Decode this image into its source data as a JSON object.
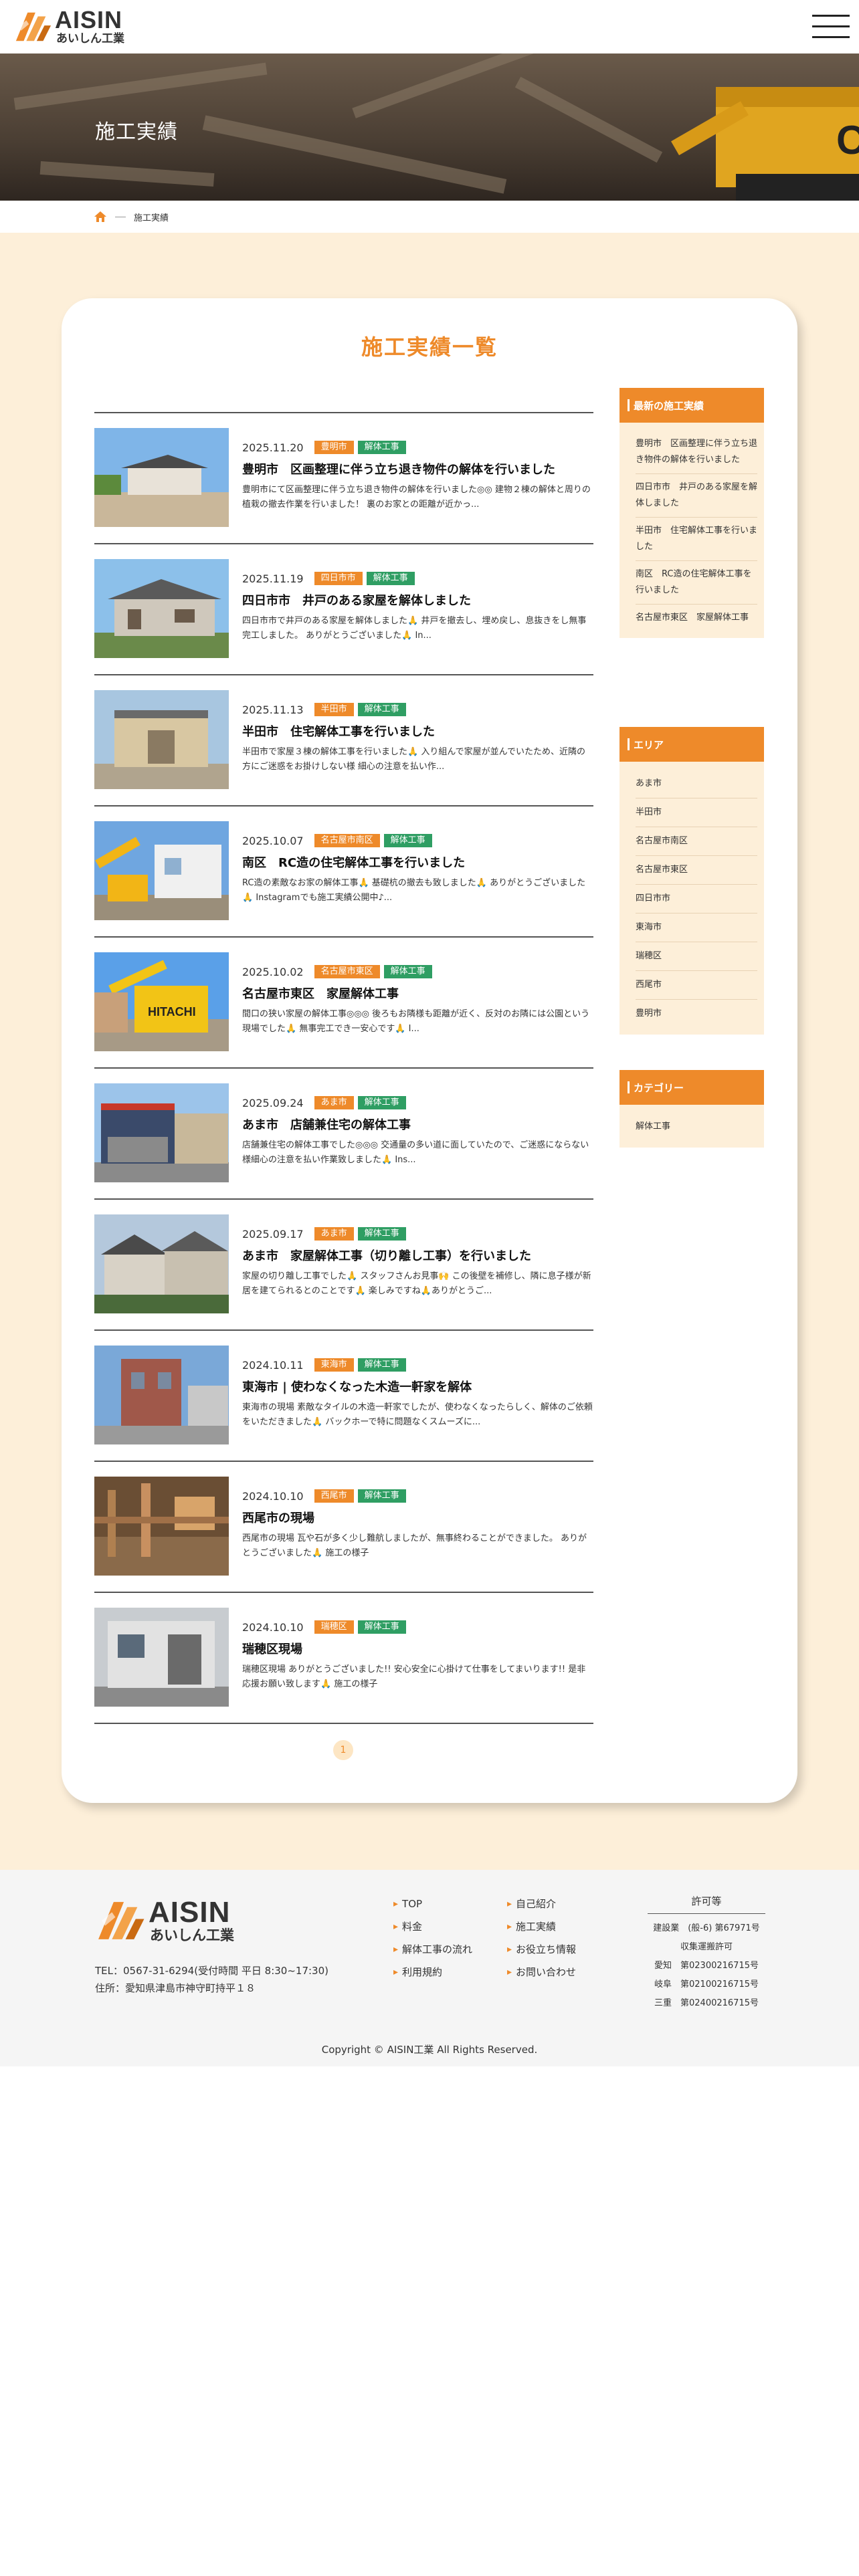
{
  "header": {
    "logo_en": "AISIN",
    "logo_ja": "あいしん工業",
    "menu_icon": "hamburger-icon"
  },
  "hero": {
    "title": "施工実績"
  },
  "breadcrumb": {
    "home_icon": "home-icon",
    "current": "施工実績"
  },
  "section_title": "施工実績一覧",
  "posts": [
    {
      "date": "2025.11.20",
      "area": "豊明市",
      "category": "解体工事",
      "title": "豊明市　区画整理に伴う立ち退き物件の解体を行いました",
      "excerpt": "豊明市にて区画整理に伴う立ち退き物件の解体を行いました◎◎ 建物２棟の解体と周りの植栽の撤去作業を行いました！ 裏のお家との距離が近かっ..."
    },
    {
      "date": "2025.11.19",
      "area": "四日市市",
      "category": "解体工事",
      "title": "四日市市　井戸のある家屋を解体しました",
      "excerpt": "四日市市で井戸のある家屋を解体しました🙏 井戸を撤去し、埋め戻し、息抜きをし無事完工しました。 ありがとうございました🙏 In..."
    },
    {
      "date": "2025.11.13",
      "area": "半田市",
      "category": "解体工事",
      "title": "半田市　住宅解体工事を行いました",
      "excerpt": "半田市で家屋３棟の解体工事を行いました🙏 入り組んで家屋が並んでいたため、近隣の方にご迷惑をお掛けしない様 細心の注意を払い作..."
    },
    {
      "date": "2025.10.07",
      "area": "名古屋市南区",
      "category": "解体工事",
      "title": "南区　RC造の住宅解体工事を行いました",
      "excerpt": "RC造の素敵なお家の解体工事🙏 基礎杭の撤去も致しました🙏 ありがとうございました🙏 Instagramでも施工実績公開中♪..."
    },
    {
      "date": "2025.10.02",
      "area": "名古屋市東区",
      "category": "解体工事",
      "title": "名古屋市東区　家屋解体工事",
      "excerpt": "間口の狭い家屋の解体工事◎◎◎ 後ろもお隣様も距離が近く、反対のお隣には公園という現場でした🙏 無事完工でき一安心です🙏 I..."
    },
    {
      "date": "2025.09.24",
      "area": "あま市",
      "category": "解体工事",
      "title": "あま市　店舗兼住宅の解体工事",
      "excerpt": "店舗兼住宅の解体工事でした◎◎◎ 交通量の多い道に面していたので、ご迷惑にならない様細心の注意を払い作業致しました🙏 Ins..."
    },
    {
      "date": "2025.09.17",
      "area": "あま市",
      "category": "解体工事",
      "title": "あま市　家屋解体工事（切り離し工事）を行いました",
      "excerpt": "家屋の切り離し工事でした🙏 スタッフさんお見事🙌 この後壁を補修し、隣に息子様が新居を建てられるとのことです🙏 楽しみですね🙏ありがとうご..."
    },
    {
      "date": "2024.10.11",
      "area": "東海市",
      "category": "解体工事",
      "title": "東海市 | 使わなくなった木造一軒家を解体",
      "excerpt": "東海市の現場 素敵なタイルの木造一軒家でしたが、使わなくなったらしく、解体のご依頼をいただきました🙏 バックホーで特に問題なくスムーズに..."
    },
    {
      "date": "2024.10.10",
      "area": "西尾市",
      "category": "解体工事",
      "title": "西尾市の現場",
      "excerpt": "西尾市の現場 瓦や石が多く少し難航しましたが、無事終わることができました。 ありがとうございました🙏 施工の様子"
    },
    {
      "date": "2024.10.10",
      "area": "瑞穂区",
      "category": "解体工事",
      "title": "瑞穂区現場",
      "excerpt": "瑞穂区現場 ありがとうございました!! 安心安全に心掛けて仕事をしてまいります!! 是非応援お願い致します🙏 施工の様子"
    }
  ],
  "pagination": {
    "current": "1"
  },
  "sidebar": {
    "recent": {
      "title": "最新の施工実績",
      "items": [
        "豊明市　区画整理に伴う立ち退き物件の解体を行いました",
        "四日市市　井戸のある家屋を解体しました",
        "半田市　住宅解体工事を行いました",
        "南区　RC造の住宅解体工事を行いました",
        "名古屋市東区　家屋解体工事"
      ]
    },
    "areas": {
      "title": "エリア",
      "items": [
        "あま市",
        "半田市",
        "名古屋市南区",
        "名古屋市東区",
        "四日市市",
        "東海市",
        "瑞穂区",
        "西尾市",
        "豊明市"
      ]
    },
    "categories": {
      "title": "カテゴリー",
      "items": [
        "解体工事"
      ]
    }
  },
  "footer": {
    "logo_en": "AISIN",
    "logo_ja": "あいしん工業",
    "tel": "TEL：0567-31-6294(受付時間 平日 8:30~17:30)",
    "address": "住所：愛知県津島市神守町持平１８",
    "nav_col1": [
      "TOP",
      "料金",
      "解体工事の流れ",
      "利用規約"
    ],
    "nav_col2": [
      "自己紹介",
      "施工実績",
      "お役立ち情報",
      "お問い合わせ"
    ],
    "license": {
      "title": "許可等",
      "rows": [
        "建設業　(般-6) 第67971号",
        "収集運搬許可",
        "愛知　第02300216715号",
        "岐阜　第02100216715号",
        "三重　第02400216715号"
      ]
    },
    "copyright": "Copyright © AISIN工業 All Rights Reserved."
  },
  "colors": {
    "accent": "#ee8a2a",
    "category_tag": "#2f9e63",
    "main_bg": "#fdefd9"
  }
}
